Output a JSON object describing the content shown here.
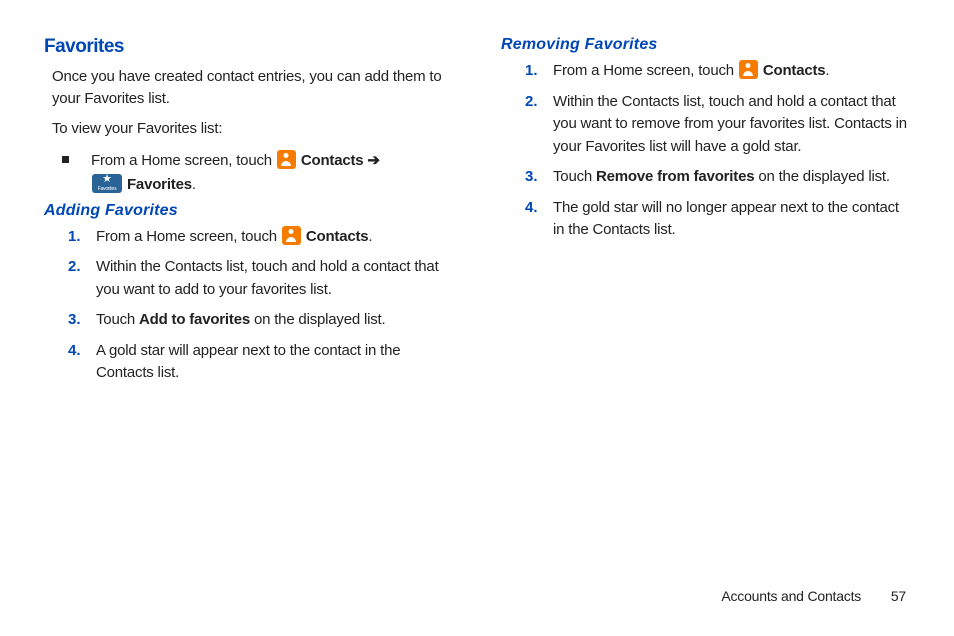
{
  "left": {
    "heading": "Favorites",
    "intro1": "Once you have created contact entries, you can add them to your Favorites list.",
    "intro2": "To view your Favorites list:",
    "bullet_prefix": "From a Home screen, touch ",
    "bullet_contacts": "Contacts",
    "bullet_arrow": " ➔ ",
    "bullet_favorites": "Favorites",
    "bullet_period": ".",
    "sub_add": "Adding Favorites",
    "add_steps": {
      "s1_prefix": "From a Home screen, touch ",
      "s1_bold": "Contacts",
      "s1_suffix": ".",
      "s2": "Within the Contacts list, touch and hold a contact that you want to add to your favorites list.",
      "s3_prefix": "Touch ",
      "s3_bold": "Add to favorites",
      "s3_suffix": " on the displayed list.",
      "s4": "A gold star will appear next to the contact in the Contacts list."
    }
  },
  "right": {
    "sub_remove": "Removing Favorites",
    "remove_steps": {
      "s1_prefix": "From a Home screen, touch ",
      "s1_bold": "Contacts",
      "s1_suffix": ".",
      "s2": "Within the Contacts list, touch and hold a contact that you want to remove from your favorites list. Contacts in your Favorites list will have a gold star.",
      "s3_prefix": "Touch ",
      "s3_bold": "Remove from favorites",
      "s3_suffix": " on the displayed list.",
      "s4": "The gold star will no longer appear next to the contact in the Contacts list."
    }
  },
  "nums": {
    "n1": "1.",
    "n2": "2.",
    "n3": "3.",
    "n4": "4."
  },
  "footer": {
    "section": "Accounts and Contacts",
    "page": "57"
  }
}
